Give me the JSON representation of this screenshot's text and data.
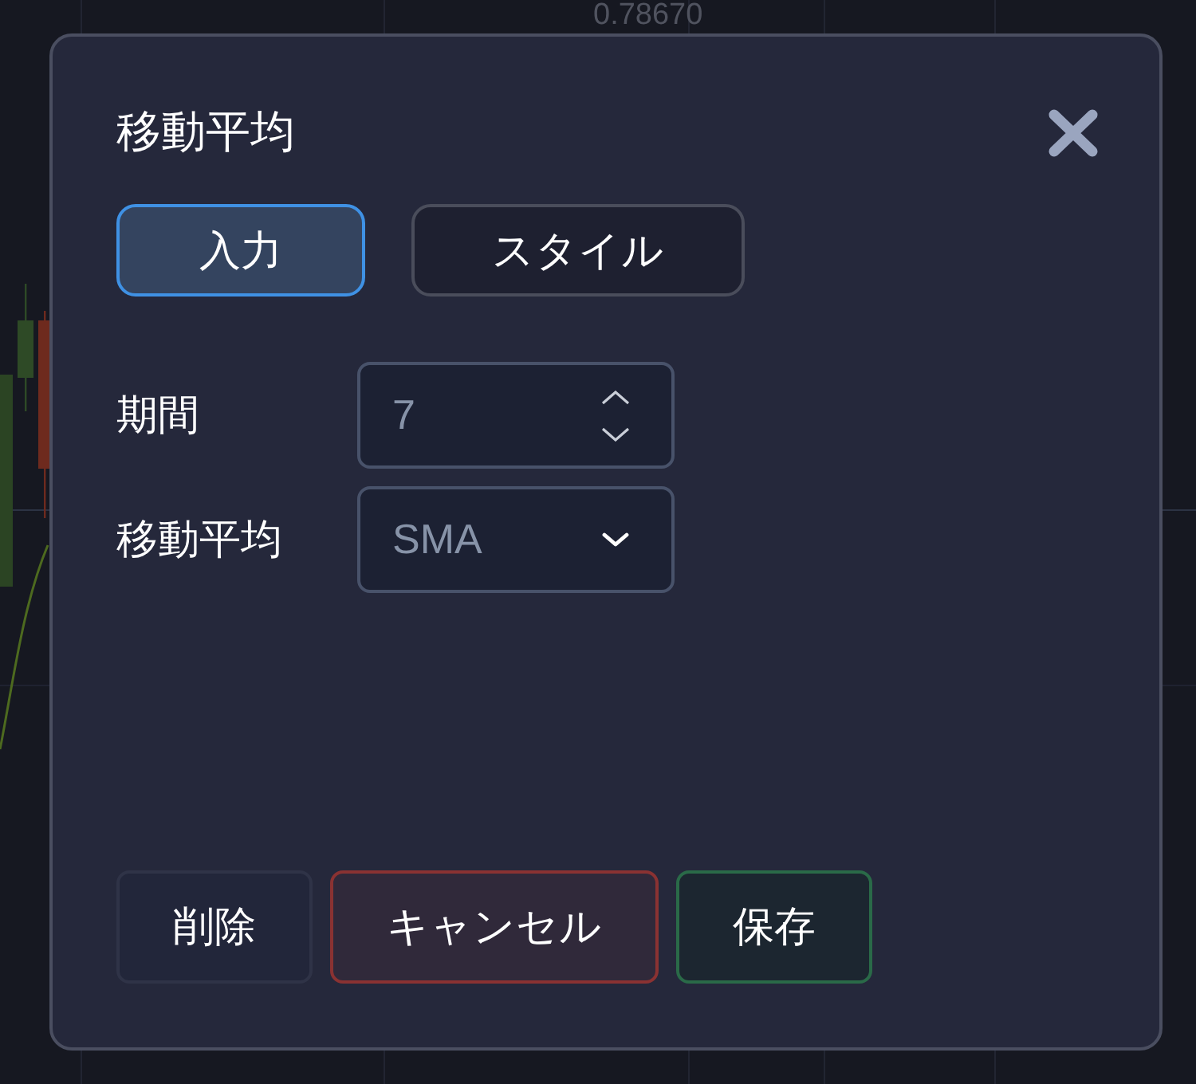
{
  "background": {
    "price_label": "0.78670"
  },
  "dialog": {
    "title": "移動平均",
    "tabs": [
      {
        "label": "入力",
        "selected": true
      },
      {
        "label": "スタイル",
        "selected": false
      }
    ],
    "fields": [
      {
        "kind": "number",
        "label": "期間",
        "value": "7"
      },
      {
        "kind": "select",
        "label": "移動平均",
        "value": "SMA"
      }
    ],
    "buttons": [
      {
        "kind": "neutral",
        "label": "削除"
      },
      {
        "kind": "danger",
        "label": "キャンセル"
      },
      {
        "kind": "success",
        "label": "保存"
      }
    ]
  }
}
